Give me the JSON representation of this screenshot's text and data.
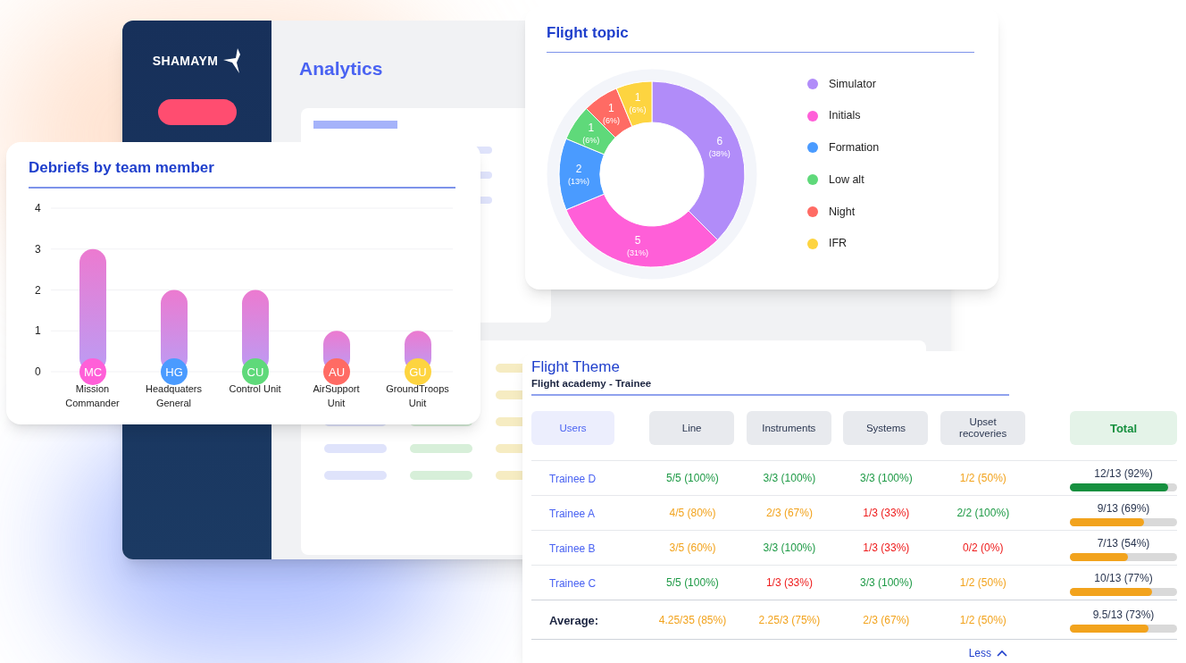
{
  "app": {
    "logo": "SHAMAYM",
    "title": "Analytics"
  },
  "debriefs": {
    "title": "Debriefs by team member",
    "chart_data": {
      "type": "bar",
      "categories": [
        "Mission Commander",
        "Headquaters General",
        "Control Unit",
        "AirSupport Unit",
        "GroundTroops Unit"
      ],
      "values": [
        3,
        2,
        2,
        1,
        1
      ],
      "ylim": [
        0,
        4
      ],
      "yticks": [
        0,
        1,
        2,
        3,
        4
      ],
      "grid": true
    },
    "avatars": [
      {
        "initials": "MC",
        "color": "#ff5fd8"
      },
      {
        "initials": "HG",
        "color": "#4a9bff"
      },
      {
        "initials": "CU",
        "color": "#5fd97a"
      },
      {
        "initials": "AU",
        "color": "#ff6b64"
      },
      {
        "initials": "GU",
        "color": "#fdd440"
      }
    ]
  },
  "flight_topic": {
    "title": "Flight topic",
    "chart_data": {
      "type": "donut",
      "categories": [
        "Simulator",
        "Initials",
        "Formation",
        "Low alt",
        "Night",
        "IFR"
      ],
      "values": [
        6,
        5,
        2,
        1,
        1,
        1
      ],
      "data_labels": true
    },
    "slice_labels": [
      {
        "count": "6",
        "share": "(38%)"
      },
      {
        "count": "5",
        "share": "(31%)"
      },
      {
        "count": "2",
        "share": "(13%)"
      },
      {
        "count": "1",
        "share": "(6%)"
      },
      {
        "count": "1",
        "share": "(6%)"
      },
      {
        "count": "1",
        "share": "(6%)"
      }
    ],
    "legend": [
      {
        "color": "#b18cf9"
      },
      {
        "color": "#ff5fd8"
      },
      {
        "color": "#4a9bff"
      },
      {
        "color": "#5fd97a"
      },
      {
        "color": "#ff6b64"
      },
      {
        "color": "#fdd440"
      }
    ]
  },
  "flight_theme": {
    "title": "Flight Theme",
    "subtitle": "Flight academy - Trainee",
    "columns": [
      {
        "label": "Users",
        "kind": "users"
      },
      {
        "label": "Line",
        "kind": "score"
      },
      {
        "label": "Instruments",
        "kind": "score"
      },
      {
        "label": "Systems",
        "kind": "score"
      },
      {
        "label": "Upset recoveries",
        "kind": "score"
      },
      {
        "label": "Total",
        "kind": "total"
      }
    ],
    "rows": [
      {
        "cells": [
          {
            "text": "Trainee D",
            "kind": "user"
          },
          {
            "text": "5/5 (100%)",
            "color": "#1e9a46"
          },
          {
            "text": "3/3 (100%)",
            "color": "#1e9a46"
          },
          {
            "text": "3/3 (100%)",
            "color": "#1e9a46"
          },
          {
            "text": "1/2 (50%)",
            "color": "#f2a31d"
          }
        ],
        "total": {
          "text": "12/13 (92%)",
          "level": 0.92,
          "color": "#16903f"
        }
      },
      {
        "cells": [
          {
            "text": "Trainee A",
            "kind": "user"
          },
          {
            "text": "4/5 (80%)",
            "color": "#f2a31d"
          },
          {
            "text": "2/3 (67%)",
            "color": "#f2a31d"
          },
          {
            "text": "1/3 (33%)",
            "color": "#ee1c1c"
          },
          {
            "text": "2/2 (100%)",
            "color": "#1e9a46"
          }
        ],
        "total": {
          "text": "9/13 (69%)",
          "level": 0.69,
          "color": "#f2a31d"
        }
      },
      {
        "cells": [
          {
            "text": "Trainee B",
            "kind": "user"
          },
          {
            "text": "3/5 (60%)",
            "color": "#f2a31d"
          },
          {
            "text": "3/3 (100%)",
            "color": "#1e9a46"
          },
          {
            "text": "1/3 (33%)",
            "color": "#ee1c1c"
          },
          {
            "text": "0/2 (0%)",
            "color": "#ee1c1c"
          }
        ],
        "total": {
          "text": "7/13 (54%)",
          "level": 0.54,
          "color": "#f2a31d"
        }
      },
      {
        "cells": [
          {
            "text": "Trainee C",
            "kind": "user"
          },
          {
            "text": "5/5 (100%)",
            "color": "#1e9a46"
          },
          {
            "text": "1/3 (33%)",
            "color": "#ee1c1c"
          },
          {
            "text": "3/3 (100%)",
            "color": "#1e9a46"
          },
          {
            "text": "1/2 (50%)",
            "color": "#f2a31d"
          }
        ],
        "total": {
          "text": "10/13 (77%)",
          "level": 0.77,
          "color": "#f2a31d"
        }
      },
      {
        "cells": [
          {
            "text": "Average:",
            "kind": "average"
          },
          {
            "text": "4.25/35 (85%)",
            "color": "#f2a31d"
          },
          {
            "text": "2.25/3 (75%)",
            "color": "#f2a31d"
          },
          {
            "text": "2/3 (67%)",
            "color": "#f2a31d"
          },
          {
            "text": "1/2 (50%)",
            "color": "#f2a31d"
          }
        ],
        "total": {
          "text": "9.5/13 (73%)",
          "level": 0.73,
          "color": "#f2a31d"
        }
      }
    ],
    "toggle": "Less"
  }
}
